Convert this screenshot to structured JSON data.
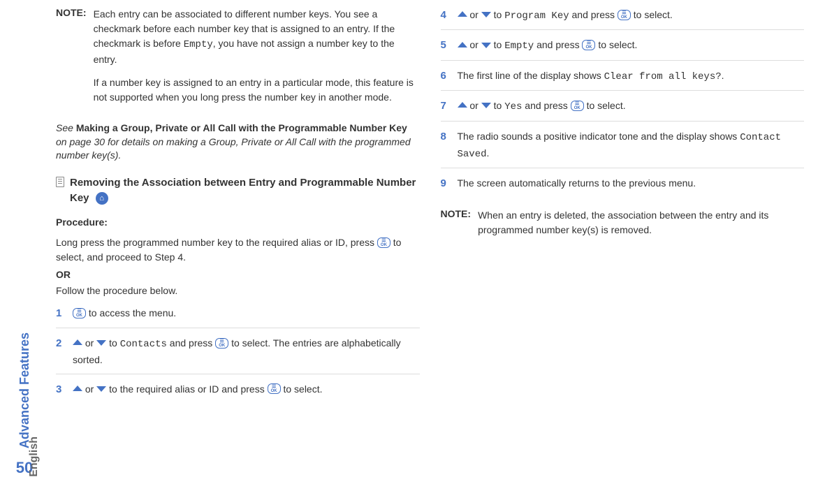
{
  "sidebar": {
    "section_label": "Advanced Features",
    "language": "English",
    "page_number": "50"
  },
  "left_column": {
    "note_label": "NOTE:",
    "note_p1_a": "Each entry can be associated to different number keys. You see a checkmark before each number key that is assigned to an entry. If the checkmark is before ",
    "note_p1_code": "Empty",
    "note_p1_b": ", you have not assign a number key to the entry.",
    "note_p2": "If a number key is assigned to an entry in a particular mode, this feature is not supported when you long press the number key in another mode.",
    "see_a": "See ",
    "see_bold": "Making a Group, Private or All Call with the Programmable Number Key",
    "see_b": " on page 30 for details on making a Group, Private or All Call with the programmed number key(s).",
    "heading": "Removing the Association between Entry and Programmable Number Key",
    "procedure_label": "Procedure:",
    "proc_text_a": "Long press the programmed number key to the required alias or ID, press ",
    "proc_text_b": " to select, and proceed to Step 4.",
    "or_label": "OR",
    "follow_text": "Follow the procedure below.",
    "steps": [
      {
        "num": "1",
        "type": "ok_only",
        "tail": " to access the menu."
      },
      {
        "num": "2",
        "type": "nav",
        "mid_a": " to ",
        "code": "Contacts",
        "mid_b": " and press ",
        "tail": " to select. The entries are alphabetically sorted."
      },
      {
        "num": "3",
        "type": "nav_plain",
        "mid_a": " to the required alias or ID and press ",
        "tail": " to select."
      }
    ]
  },
  "right_column": {
    "steps": [
      {
        "num": "4",
        "type": "nav",
        "mid_a": " to ",
        "code": "Program Key",
        "mid_b": " and press ",
        "tail": " to select."
      },
      {
        "num": "5",
        "type": "nav",
        "mid_a": " to ",
        "code": "Empty",
        "mid_b": " and press ",
        "tail": " to select."
      },
      {
        "num": "6",
        "type": "plain_code",
        "text_a": "The first line of the display shows ",
        "code": "Clear from all keys?",
        "text_b": "."
      },
      {
        "num": "7",
        "type": "nav",
        "mid_a": " to ",
        "code": "Yes",
        "mid_b": " and press ",
        "tail": " to select."
      },
      {
        "num": "8",
        "type": "plain_code",
        "text_a": "The radio sounds a positive indicator tone and the display shows ",
        "code": "Contact Saved",
        "text_b": "."
      },
      {
        "num": "9",
        "type": "plain",
        "text": "The screen automatically returns to the previous menu."
      }
    ],
    "note_label": "NOTE:",
    "note_text": "When an entry is deleted, the association between the entry and its programmed number key(s) is removed."
  },
  "or_word": " or "
}
